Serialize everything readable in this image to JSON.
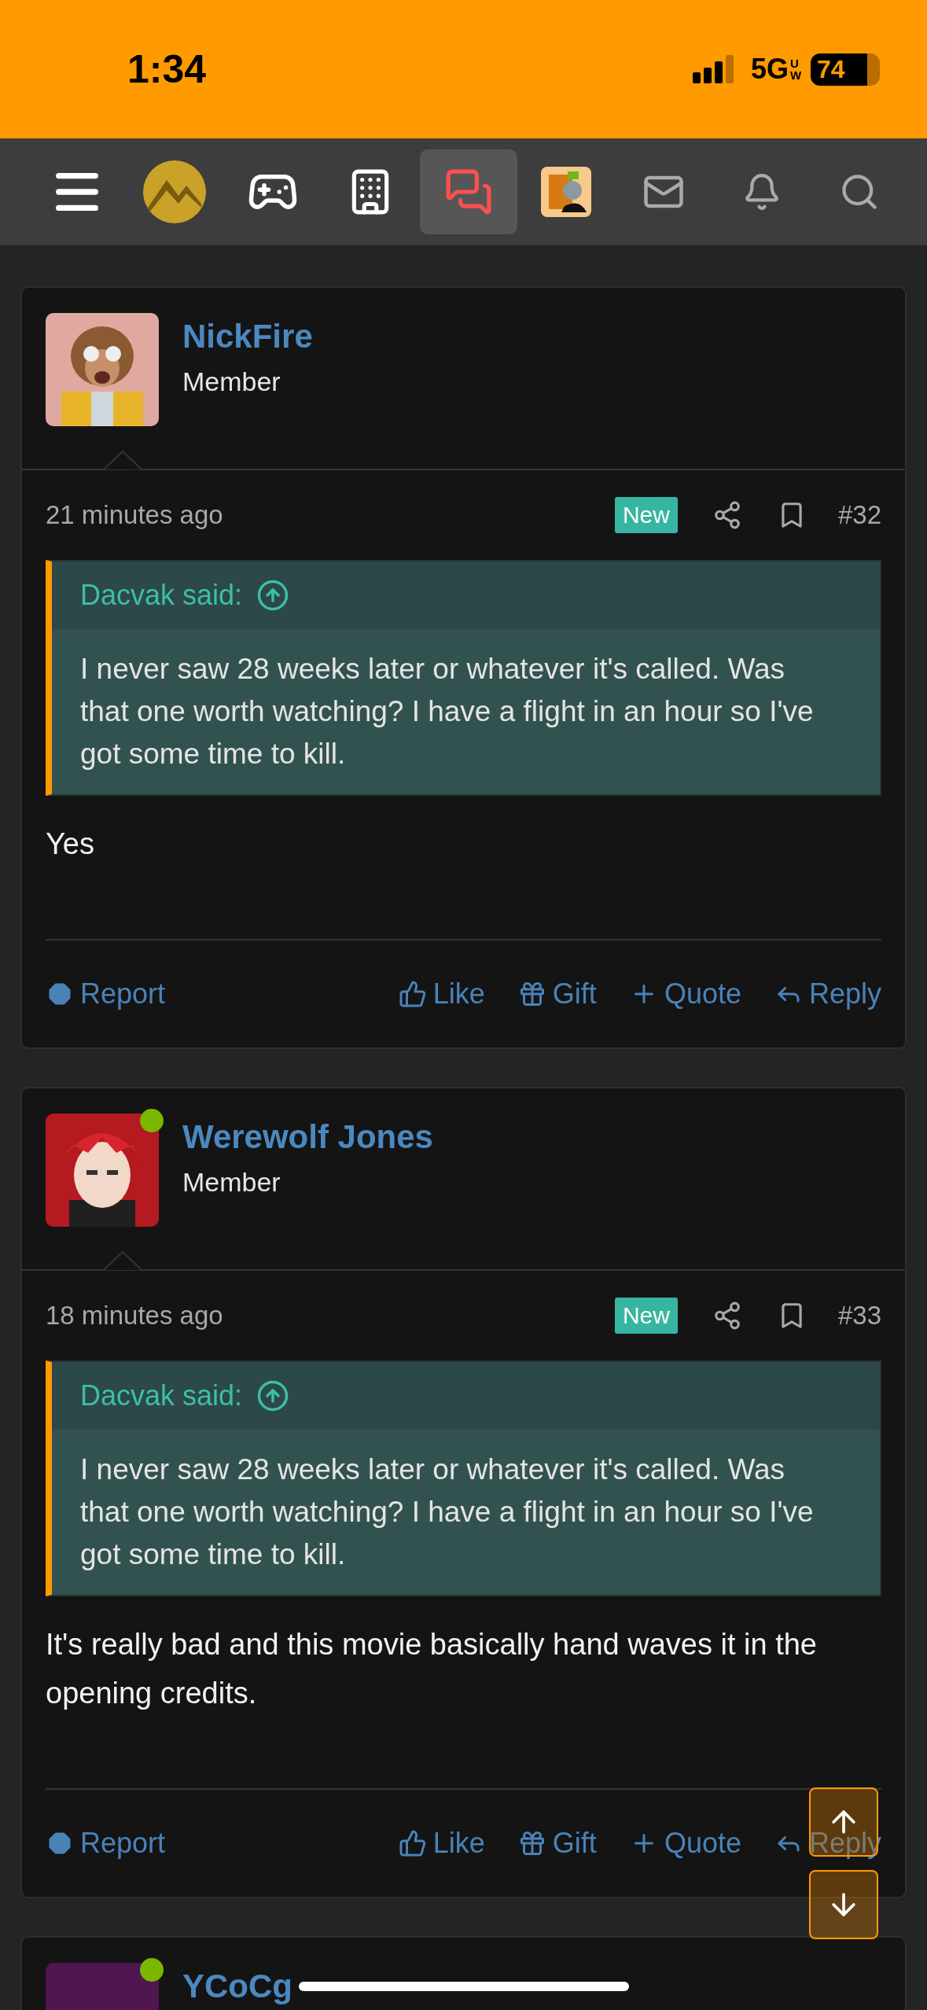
{
  "status_bar": {
    "time": "1:34",
    "network": "5G",
    "network_sub": "UW",
    "battery": "74"
  },
  "nav": {
    "items": [
      {
        "kind": "menu",
        "selected": false
      },
      {
        "kind": "logo",
        "selected": false
      },
      {
        "kind": "games",
        "selected": false
      },
      {
        "kind": "building",
        "selected": false
      },
      {
        "kind": "chat",
        "selected": true
      },
      {
        "kind": "avatar",
        "selected": false
      },
      {
        "kind": "mail",
        "selected": false
      },
      {
        "kind": "bell",
        "selected": false
      },
      {
        "kind": "search",
        "selected": false
      }
    ]
  },
  "posts": [
    {
      "user": "NickFire",
      "role": "Member",
      "online": false,
      "time": "21 minutes ago",
      "badge": "New",
      "number": "#32",
      "quote": {
        "author": "Dacvak said:",
        "text": "I never saw 28 weeks later or whatever it's called. Was that one worth watching? I have a flight in an hour so I've got some time to kill."
      },
      "message": "Yes",
      "actions": [
        "Report",
        "Like",
        "Gift",
        "Quote",
        "Reply"
      ]
    },
    {
      "user": "Werewolf Jones",
      "role": "Member",
      "online": true,
      "time": "18 minutes ago",
      "badge": "New",
      "number": "#33",
      "quote": {
        "author": "Dacvak said:",
        "text": "I never saw 28 weeks later or whatever it's called. Was that one worth watching? I have a flight in an hour so I've got some time to kill."
      },
      "message": "It's really bad and this movie basically hand waves it in the opening credits.",
      "actions": [
        "Report",
        "Like",
        "Gift",
        "Quote",
        "Reply"
      ]
    },
    {
      "user": "YCoCg",
      "online": true
    }
  ]
}
